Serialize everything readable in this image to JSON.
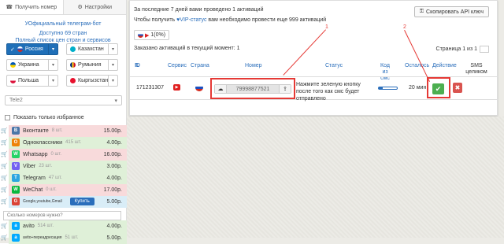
{
  "sidebar": {
    "tabs": [
      "Получить номер",
      "Настройки"
    ],
    "links": [
      "УОфициальный телеграм-бот",
      "Доступно 69 стран",
      "Полный список цен стран и сервисов"
    ],
    "countries": [
      {
        "name": "Россия",
        "color": "#1f6fb8"
      },
      {
        "name": "Казахстан",
        "color": "#00afca"
      },
      {
        "name": "Украина",
        "color": "#f7d117"
      },
      {
        "name": "Румыния",
        "color": "#fcd116"
      },
      {
        "name": "Польша",
        "color": "#dc143c"
      },
      {
        "name": "Кыргызстан",
        "color": "#e8112d"
      }
    ],
    "search_value": "Tele2",
    "favorites_label": "Показать только избранное",
    "services": [
      {
        "name": "Вконтакте",
        "count": "8 шт.",
        "price": "15.00р.",
        "bg": "#f8dadb",
        "icon": "vk-icon",
        "ic_color": "#4a76a8",
        "ic": "B"
      },
      {
        "name": "Одноклассники",
        "count": "415 шт.",
        "price": "4.00р.",
        "bg": "#dff0d8",
        "icon": "ok-icon",
        "ic_color": "#ee8208",
        "ic": "O"
      },
      {
        "name": "Whatsapp",
        "count": "0 шт.",
        "price": "16.00р.",
        "bg": "#f8dadb",
        "icon": "whatsapp-icon",
        "ic_color": "#25d366",
        "ic": "W"
      },
      {
        "name": "Viber",
        "count": "23 шт.",
        "price": "3.00р.",
        "bg": "#dff0d8",
        "icon": "viber-icon",
        "ic_color": "#7360f2",
        "ic": "V"
      },
      {
        "name": "Telegram",
        "count": "47 шт.",
        "price": "4.00р.",
        "bg": "#dff0d8",
        "icon": "telegram-icon",
        "ic_color": "#2ca5e0",
        "ic": "T"
      },
      {
        "name": "WeChat",
        "count": "0 шт.",
        "price": "17.00р.",
        "bg": "#f8dadb",
        "icon": "wechat-icon",
        "ic_color": "#09b83e",
        "ic": "W"
      },
      {
        "name": "Google,youtube,Gmail",
        "count": "",
        "price": "5.00р.",
        "bg": "#d9edf7",
        "icon": "google-icon",
        "ic_color": "#db4437",
        "ic": "G",
        "buy": "Купить"
      },
      {
        "name": "avito",
        "count": "514 шт.",
        "price": "4.00р.",
        "bg": "#dff0d8",
        "icon": "avito-icon",
        "ic_color": "#00aaff",
        "ic": "a"
      },
      {
        "name": "avito+переадресация",
        "count": "51 шт.",
        "price": "5.00р.",
        "bg": "#dff0d8",
        "icon": "avito-forward-icon",
        "ic_color": "#00aaff",
        "ic": "a"
      }
    ],
    "qty_placeholder": "Сколько номеров нужно?"
  },
  "panel": {
    "line1": "За последние 7 дней вами проведено 1 активаций",
    "line2_a": "Чтобы получить ",
    "line2_vip": "VIP-статус",
    "line2_b": " вам необходимо провести еще 999 активаций",
    "copy_api": "Скопировать API ключ",
    "activations_badge": "1(0%)",
    "current": "Заказано активаций в текущий момент: 1",
    "page": "Страница 1 из 1",
    "headers": {
      "id": "ID",
      "service": "Сервис",
      "country": "Страна",
      "number": "Номер",
      "status": "Статус",
      "code": "Код из смс",
      "remaining": "Осталось",
      "action": "Действие",
      "sms": "SMS целиком"
    },
    "row": {
      "id": "171231307",
      "number": "79998877521",
      "status": "Нажмите зеленую кнопку после того как смс будет отправлено",
      "progress": 0.2,
      "remaining": "20 мин"
    },
    "annotations": [
      "1",
      "2"
    ]
  }
}
